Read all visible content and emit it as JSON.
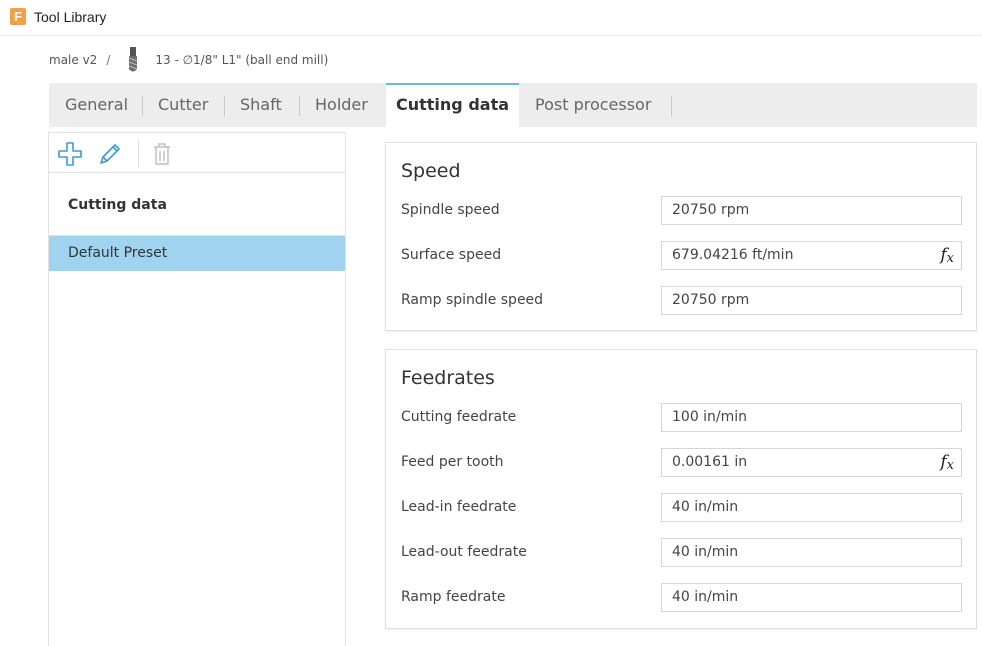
{
  "window": {
    "title": "Tool Library",
    "logo_letter": "F",
    "logo_color": "#f2a045"
  },
  "breadcrumb": {
    "library": "male v2",
    "separator": "/",
    "tool": "13 - ∅1/8\" L1\" (ball end mill)"
  },
  "tabs": [
    {
      "label": "General",
      "active": false
    },
    {
      "label": "Cutter",
      "active": false
    },
    {
      "label": "Shaft",
      "active": false
    },
    {
      "label": "Holder",
      "active": false
    },
    {
      "label": "Cutting data",
      "active": true
    },
    {
      "label": "Post processor",
      "active": false
    }
  ],
  "presets": {
    "toolbar": {
      "add_icon": "plus-icon",
      "edit_icon": "pencil-icon",
      "delete_icon": "trash-icon"
    },
    "header": "Cutting data",
    "items": [
      {
        "label": "Default Preset",
        "selected": true
      }
    ]
  },
  "speed": {
    "title": "Speed",
    "rows": [
      {
        "label": "Spindle speed",
        "value": "20750 rpm",
        "formula": false
      },
      {
        "label": "Surface speed",
        "value": "679.04216 ft/min",
        "formula": true
      },
      {
        "label": "Ramp spindle speed",
        "value": "20750 rpm",
        "formula": false
      }
    ]
  },
  "feedrates": {
    "title": "Feedrates",
    "rows": [
      {
        "label": "Cutting feedrate",
        "value": "100 in/min",
        "formula": false
      },
      {
        "label": "Feed per tooth",
        "value": "0.00161 in",
        "formula": true
      },
      {
        "label": "Lead-in feedrate",
        "value": "40 in/min",
        "formula": false
      },
      {
        "label": "Lead-out feedrate",
        "value": "40 in/min",
        "formula": false
      },
      {
        "label": "Ramp feedrate",
        "value": "40 in/min",
        "formula": false
      }
    ]
  },
  "formula_button": {
    "symbol": "f",
    "sub": "x"
  },
  "colors": {
    "accent": "#6ab8dc",
    "selection": "#9fd3ef",
    "icon_blue": "#3a9bd5"
  }
}
